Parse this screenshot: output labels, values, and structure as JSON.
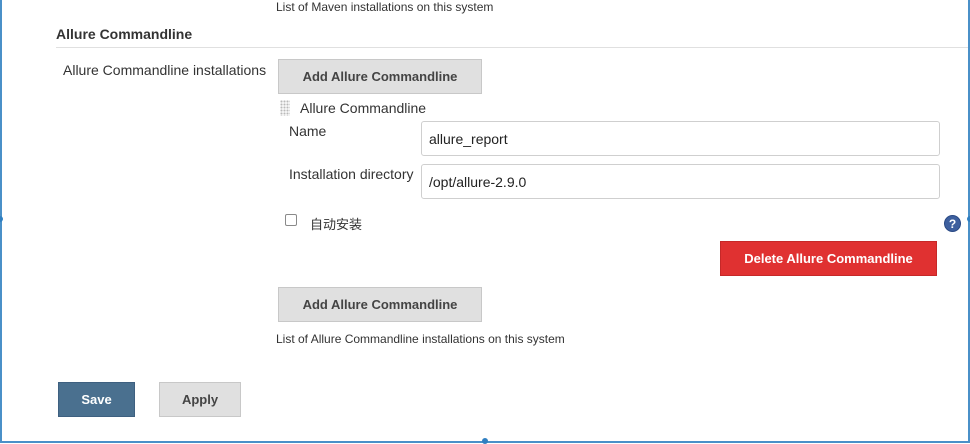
{
  "maven": {
    "description": "List of Maven installations on this system"
  },
  "allure": {
    "section_title": "Allure Commandline",
    "installations_label": "Allure Commandline installations",
    "add_button_label": "Add Allure Commandline",
    "item": {
      "title": "Allure Commandline",
      "name_label": "Name",
      "name_value": "allure_report",
      "dir_label": "Installation directory",
      "dir_value": "/opt/allure-2.9.0",
      "auto_install_label": "自动安装",
      "auto_install_checked": false,
      "help_icon_text": "?",
      "delete_button_label": "Delete Allure Commandline"
    },
    "description": "List of Allure Commandline installations on this system"
  },
  "footer": {
    "save_label": "Save",
    "apply_label": "Apply"
  },
  "colors": {
    "delete_button": "#e03131",
    "save_button": "#4a708f",
    "help_icon": "#3d5f9e"
  }
}
